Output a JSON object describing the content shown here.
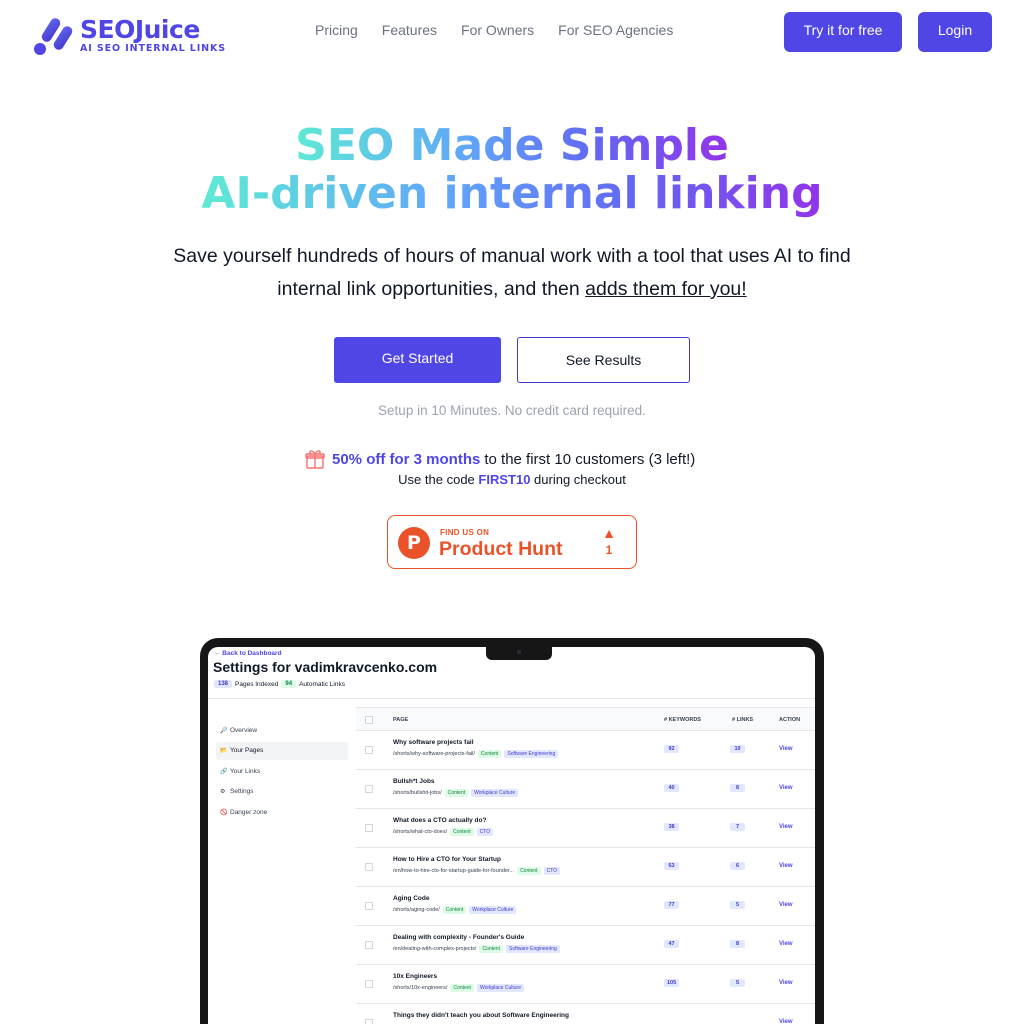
{
  "brand": {
    "name": "SEOJuice",
    "tagline": "AI SEO INTERNAL LINKS",
    "accent": "#4f46e5"
  },
  "nav": {
    "links": [
      "Pricing",
      "Features",
      "For Owners",
      "For SEO Agencies"
    ],
    "try_label": "Try it for free",
    "login_label": "Login"
  },
  "hero": {
    "title_line1": "SEO Made Simple",
    "title_line2": "AI-driven internal linking",
    "subtitle_pre": "Save yourself hundreds of hours of manual work with a tool that uses AI to find internal link opportunities, and then ",
    "subtitle_link": "adds them for you!",
    "get_started": "Get Started",
    "see_results": "See Results",
    "setup_note": "Setup in 10 Minutes. No credit card required."
  },
  "promo": {
    "highlight": "50% off for 3 months",
    "rest": "to the first 10 customers (3 left!)",
    "code_pre": "Use the code",
    "code": "FIRST10",
    "code_post": "during checkout",
    "icon": "gift-icon"
  },
  "product_hunt": {
    "small": "FIND US ON",
    "big": "Product Hunt",
    "upvote_glyph": "▲",
    "count": "1",
    "color": "#ea532a"
  },
  "dashboard": {
    "back": "← Back to Dashboard",
    "title": "Settings for vadimkravcenko.com",
    "pages_indexed": "138",
    "pages_indexed_label": "Pages Indexed",
    "auto_links": "94",
    "auto_links_label": "Automatic Links",
    "sidebar": [
      {
        "icon": "🔎",
        "label": "Overview"
      },
      {
        "icon": "📂",
        "label": "Your Pages"
      },
      {
        "icon": "🔗",
        "label": "Your Links"
      },
      {
        "icon": "⚙",
        "label": "Settings"
      },
      {
        "icon": "🚫",
        "label": "Danger zone"
      }
    ],
    "columns": [
      "PAGE",
      "# KEYWORDS",
      "# LINKS",
      "ACTION"
    ],
    "rows": [
      {
        "title": "Why software projects fail",
        "path": "/shorts/why-software-projects-fail/",
        "tag1": "Content",
        "tag2": "Software Engineering",
        "keywords": "92",
        "links": "10",
        "action": "View"
      },
      {
        "title": "Bullsh*t Jobs",
        "path": "/shorts/bullshit-jobs/",
        "tag1": "Content",
        "tag2": "Workplace Culture",
        "keywords": "40",
        "links": "8",
        "action": "View"
      },
      {
        "title": "What does a CTO actually do?",
        "path": "/shorts/what-cto-does/",
        "tag1": "Content",
        "tag2": "CTO",
        "keywords": "38",
        "links": "7",
        "action": "View"
      },
      {
        "title": "How to Hire a CTO for Your Startup",
        "path": "/en/how-to-hire-cto-for-startup-guide-for-founder...",
        "tag1": "Content",
        "tag2": "CTO",
        "keywords": "63",
        "links": "6",
        "action": "View"
      },
      {
        "title": "Aging Code",
        "path": "/shorts/aging-code/",
        "tag1": "Content",
        "tag2": "Workplace Culture",
        "keywords": "77",
        "links": "5",
        "action": "View"
      },
      {
        "title": "Dealing with complexity - Founder's Guide",
        "path": "/en/dealing-with-complex-projects/",
        "tag1": "Content",
        "tag2": "Software Engineering",
        "keywords": "47",
        "links": "8",
        "action": "View"
      },
      {
        "title": "10x Engineers",
        "path": "/shorts/10x-engineers/",
        "tag1": "Content",
        "tag2": "Workplace Culture",
        "keywords": "105",
        "links": "5",
        "action": "View"
      },
      {
        "title": "Things they didn't teach you about Software Engineering",
        "path": "",
        "tag1": "",
        "tag2": "",
        "keywords": "",
        "links": "",
        "action": "View"
      }
    ]
  }
}
